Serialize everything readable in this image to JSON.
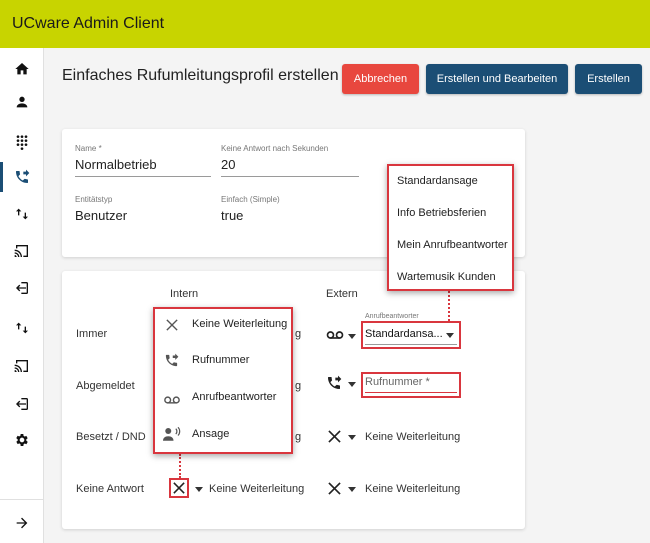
{
  "app": {
    "title": "UCware Admin Client"
  },
  "sidebar": {
    "items": [
      {
        "icon": "home-icon",
        "active": false
      },
      {
        "icon": "person-icon",
        "active": false
      },
      {
        "icon": "dialpad-icon",
        "active": false
      },
      {
        "icon": "phone-forwarded-icon",
        "active": true
      },
      {
        "icon": "swap-vert-icon",
        "active": false
      },
      {
        "icon": "cast-icon",
        "active": false
      },
      {
        "icon": "login-icon",
        "active": false
      },
      {
        "icon": "swap-vert-icon",
        "active": false
      },
      {
        "icon": "cast-icon",
        "active": false
      },
      {
        "icon": "login-icon",
        "active": false
      },
      {
        "icon": "gear-icon",
        "active": false
      }
    ],
    "expand_icon": "arrow-right-icon"
  },
  "header": {
    "title": "Einfaches Rufumleitungsprofil erstellen",
    "cancel_label": "Abbrechen",
    "create_edit_label": "Erstellen und Bearbeiten",
    "create_label": "Erstellen"
  },
  "colors": {
    "topbar": "#c8d400",
    "primary": "#1b4e75",
    "danger": "#e8473e",
    "highlight": "#d9363e"
  },
  "form": {
    "name": {
      "label": "Name *",
      "value": "Normalbetrieb"
    },
    "timeout": {
      "label": "Keine Antwort nach Sekunden",
      "value": "20"
    },
    "entity_type": {
      "label": "Entitätstyp",
      "value": "Benutzer"
    },
    "simple": {
      "label": "Einfach (Simple)",
      "value": "true"
    }
  },
  "forwarding": {
    "col_intern": "Intern",
    "col_extern": "Extern",
    "rows": [
      {
        "label": "Immer",
        "intern_tail": "g"
      },
      {
        "label": "Abgemeldet",
        "intern_tail": "g"
      },
      {
        "label": "Besetzt / DND",
        "intern_tail": "g",
        "extern": "Keine Weiterleitung"
      },
      {
        "label": "Keine Antwort",
        "intern": "Keine Weiterleitung",
        "extern": "Keine Weiterleitung"
      }
    ],
    "immer_extern": {
      "label": "Anrufbeantworter",
      "value": "Standardansa..."
    },
    "abgemeldet_extern": {
      "placeholder": "Rufnummer *"
    }
  },
  "type_menu": {
    "items": [
      {
        "icon": "close-icon",
        "label": "Keine Weiterleitung"
      },
      {
        "icon": "phone-forwarded-icon",
        "label": "Rufnummer"
      },
      {
        "icon": "voicemail-icon",
        "label": "Anrufbeantworter"
      },
      {
        "icon": "announcement-icon",
        "label": "Ansage"
      }
    ]
  },
  "announcement_menu": {
    "items": [
      "Standardansage",
      "Info Betriebsferien",
      "Mein Anrufbeantworter",
      "Wartemusik Kunden"
    ]
  }
}
